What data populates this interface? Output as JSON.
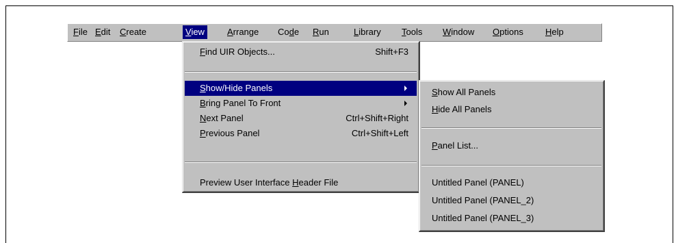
{
  "menubar": {
    "items": [
      {
        "pre": "",
        "ul": "F",
        "post": "ile"
      },
      {
        "pre": "",
        "ul": "E",
        "post": "dit"
      },
      {
        "pre": "",
        "ul": "C",
        "post": "reate"
      },
      {
        "pre": "",
        "ul": "V",
        "post": "iew"
      },
      {
        "pre": "",
        "ul": "A",
        "post": "rrange"
      },
      {
        "pre": "Co",
        "ul": "d",
        "post": "e"
      },
      {
        "pre": "",
        "ul": "R",
        "post": "un"
      },
      {
        "pre": "",
        "ul": "L",
        "post": "ibrary"
      },
      {
        "pre": "",
        "ul": "T",
        "post": "ools"
      },
      {
        "pre": "",
        "ul": "W",
        "post": "indow"
      },
      {
        "pre": "",
        "ul": "O",
        "post": "ptions"
      },
      {
        "pre": "",
        "ul": "H",
        "post": "elp"
      }
    ]
  },
  "view_menu": {
    "find": {
      "pre": "",
      "ul": "F",
      "post": "ind UIR Objects...",
      "shortcut": "Shift+F3"
    },
    "show_hide": {
      "pre": "",
      "ul": "S",
      "post": "how/Hide Panels"
    },
    "bring_front": {
      "pre": "",
      "ul": "B",
      "post": "ring Panel To Front"
    },
    "next_panel": {
      "pre": "",
      "ul": "N",
      "post": "ext Panel",
      "shortcut": "Ctrl+Shift+Right"
    },
    "prev_panel": {
      "pre": "",
      "ul": "P",
      "post": "revious Panel",
      "shortcut": "Ctrl+Shift+Left"
    },
    "preview_header": {
      "pre": "Preview User Interface ",
      "ul": "H",
      "post": "eader File"
    }
  },
  "panels_menu": {
    "show_all": {
      "pre": "",
      "ul": "S",
      "post": "how All Panels"
    },
    "hide_all": {
      "pre": "",
      "ul": "H",
      "post": "ide All Panels"
    },
    "panel_list": {
      "pre": "",
      "ul": "P",
      "post": "anel List..."
    },
    "panels": [
      "Untitled Panel (PANEL)",
      "Untitled Panel (PANEL_2)",
      "Untitled Panel (PANEL_3)"
    ]
  }
}
